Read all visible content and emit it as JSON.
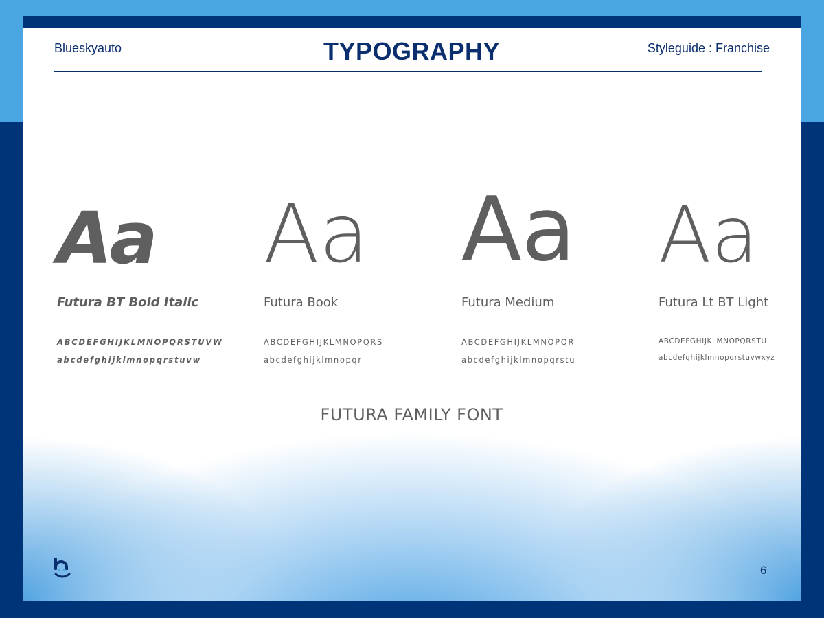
{
  "header": {
    "brand": "Blueskyauto",
    "title": "TYPOGRAPHY",
    "guide": "Styleguide : Franchise"
  },
  "fonts": [
    {
      "sample": "Aa",
      "name": "Futura BT Bold Italic",
      "uppercase": "ABCDEFGHIJKLMNOPQRSTUVW",
      "lowercase": "abcdefghijklmnopqrstuvw"
    },
    {
      "sample": "Aa",
      "name": "Futura Book",
      "uppercase": "ABCDEFGHIJKLMNOPQRS",
      "lowercase": "abcdefghijklmnopqr"
    },
    {
      "sample": "Aa",
      "name": "Futura Medium",
      "uppercase": "ABCDEFGHIJKLMNOPQR",
      "lowercase": "abcdefghijklmnopqrstu"
    },
    {
      "sample": "Aa",
      "name": "Futura Lt BT Light",
      "uppercase": "ABCDEFGHIJKLMNOPQRSTU",
      "lowercase": "abcdefghijklmnopqrstuvwxyz"
    }
  ],
  "caption": "FUTURA FAMILY FONT",
  "footer": {
    "logo_icon": "blueskyauto-smile-b-logo-icon",
    "page_number": "6"
  },
  "colors": {
    "navy": "#003478",
    "sky": "#49a6e2",
    "text_gray": "#5f5f5f"
  }
}
